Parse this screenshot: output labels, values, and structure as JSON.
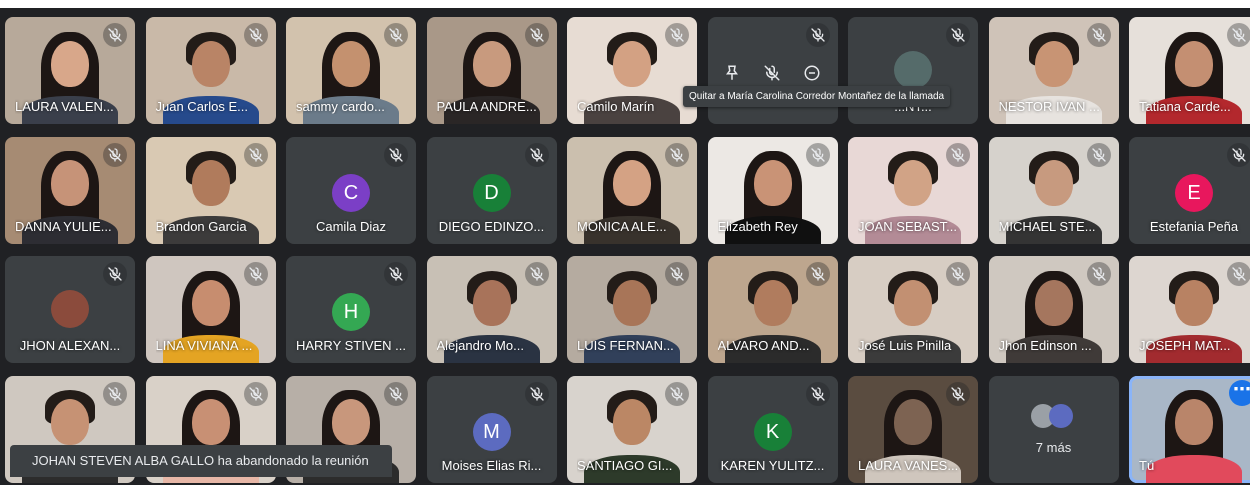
{
  "tooltip": "Quitar a María Carolina Corredor Montañez de la llamada",
  "notification": "JOHAN STEVEN ALBA GALLO ha abandonado la reunión",
  "participants": [
    {
      "name": "LAURA VALEN...",
      "kind": "video",
      "bg": "#b7a99a",
      "shirt": "#3a3f4b",
      "skin": "#d8a78a",
      "hair": "long"
    },
    {
      "name": "Juan Carlos E...",
      "kind": "video",
      "bg": "#c9b9a8",
      "shirt": "#264a8c",
      "skin": "#b98466",
      "hair": "short"
    },
    {
      "name": "sammy cardo...",
      "kind": "video",
      "bg": "#d2c2ad",
      "shirt": "#6b7b8a",
      "skin": "#c4916f",
      "hair": "long"
    },
    {
      "name": "PAULA ANDRE...",
      "kind": "video",
      "bg": "#a99888",
      "shirt": "#2a2626",
      "skin": "#c89a7e",
      "hair": "long"
    },
    {
      "name": "Camilo Marín",
      "kind": "video",
      "bg": "#e7dcd3",
      "shirt": "#4a4240",
      "skin": "#d3a183",
      "hair": "short"
    },
    {
      "name": "",
      "kind": "hover"
    },
    {
      "name": "...NT...",
      "kind": "small",
      "bg": "#3c4043",
      "avatar_color": "#556b6a"
    },
    {
      "name": "NESTOR IVAN ...",
      "kind": "video",
      "bg": "#cfc3b8",
      "shirt": "#e7e3df",
      "skin": "#c89474",
      "hair": "short"
    },
    {
      "name": "Tatiana Carde...",
      "kind": "video",
      "bg": "#e6e0da",
      "shirt": "#b3282d",
      "skin": "#c48f72",
      "hair": "long"
    },
    {
      "name": "DANNA YULIE...",
      "kind": "video",
      "bg": "#a68b73",
      "shirt": "#2d2d33",
      "skin": "#c69378",
      "hair": "long"
    },
    {
      "name": "Brandon Garcia",
      "kind": "video",
      "bg": "#d9c9b3",
      "shirt": "#3c3b3b",
      "skin": "#b07b5c",
      "hair": "short"
    },
    {
      "name": "Camila Diaz",
      "kind": "letter",
      "letter": "C",
      "color": "#7b3fc6"
    },
    {
      "name": "DIEGO EDINZO...",
      "kind": "letter",
      "letter": "D",
      "color": "#188038"
    },
    {
      "name": "MONICA ALE...",
      "kind": "video",
      "bg": "#cbbfae",
      "shirt": "#38322c",
      "skin": "#d4a284",
      "hair": "long"
    },
    {
      "name": "Elizabeth Rey",
      "kind": "video",
      "bg": "#ece8e4",
      "shirt": "#101010",
      "skin": "#c99376",
      "hair": "long"
    },
    {
      "name": "JOAN SEBAST...",
      "kind": "video",
      "bg": "#e8d8d6",
      "shirt": "#b38b96",
      "skin": "#d1a386",
      "hair": "short"
    },
    {
      "name": "MICHAEL STE...",
      "kind": "video",
      "bg": "#d6d2cc",
      "shirt": "#343434",
      "skin": "#c79a7f",
      "hair": "short"
    },
    {
      "name": "Estefania Peña",
      "kind": "letter",
      "letter": "E",
      "color": "#e8175d"
    },
    {
      "name": "JHON ALEXAN...",
      "kind": "small",
      "bg": "#3c4043",
      "avatar_color": "#8b4b3c"
    },
    {
      "name": "LINA VIVIANA ...",
      "kind": "video",
      "bg": "#cfc6bf",
      "shirt": "#e4a423",
      "skin": "#c78d6f",
      "hair": "long"
    },
    {
      "name": "HARRY STIVEN ...",
      "kind": "letter",
      "letter": "H",
      "color": "#34a853"
    },
    {
      "name": "Alejandro Mo...",
      "kind": "video",
      "bg": "#c8c0b5",
      "shirt": "#2a3342",
      "skin": "#a8735a",
      "hair": "short"
    },
    {
      "name": "LUIS FERNAN...",
      "kind": "video",
      "bg": "#b5aba0",
      "shirt": "#31405a",
      "skin": "#a87558",
      "hair": "short"
    },
    {
      "name": "ALVARO AND...",
      "kind": "video",
      "bg": "#bda68e",
      "shirt": "#2b2b2b",
      "skin": "#b07c5e",
      "hair": "short"
    },
    {
      "name": "José Luis Pinilla",
      "kind": "video",
      "bg": "#d7cdc3",
      "shirt": "#3b3b3b",
      "skin": "#c29072",
      "hair": "short"
    },
    {
      "name": "Jhon Edinson ...",
      "kind": "video",
      "bg": "#cfc8c0",
      "shirt": "#3f3a38",
      "skin": "#a5765e",
      "hair": "long"
    },
    {
      "name": "JOSEPH MAT...",
      "kind": "video",
      "bg": "#ddd6d0",
      "shirt": "#a22b2f",
      "skin": "#b88263",
      "hair": "short"
    },
    {
      "name": "",
      "kind": "video",
      "bg": "#cfc8c0",
      "shirt": "#2c2c2c",
      "skin": "#c69274",
      "hair": "short"
    },
    {
      "name": "",
      "kind": "video",
      "bg": "#d9d1c8",
      "shirt": "#e7b7a7",
      "skin": "#c89074",
      "hair": "long"
    },
    {
      "name": "",
      "kind": "video",
      "bg": "#b7afa7",
      "shirt": "#2c2c2c",
      "skin": "#c8977c",
      "hair": "long"
    },
    {
      "name": "Moises Elias Ri...",
      "kind": "letter",
      "letter": "M",
      "color": "#5c6bc0"
    },
    {
      "name": "SANTIAGO GI...",
      "kind": "video",
      "bg": "#d8d3cd",
      "shirt": "#2d3a2a",
      "skin": "#bb8765",
      "hair": "short"
    },
    {
      "name": "KAREN YULITZ...",
      "kind": "letter",
      "letter": "K",
      "color": "#188038"
    },
    {
      "name": "LAURA VANES...",
      "kind": "video",
      "bg": "#5a4c40",
      "shirt": "#cfc6bd",
      "skin": "#7d6352",
      "hair": "long"
    },
    {
      "name": "7 más",
      "kind": "more"
    },
    {
      "name": "Tú",
      "kind": "self",
      "bg": "#a9b7c7",
      "shirt": "#e14a5c",
      "skin": "#b9856a",
      "hair": "long"
    }
  ]
}
